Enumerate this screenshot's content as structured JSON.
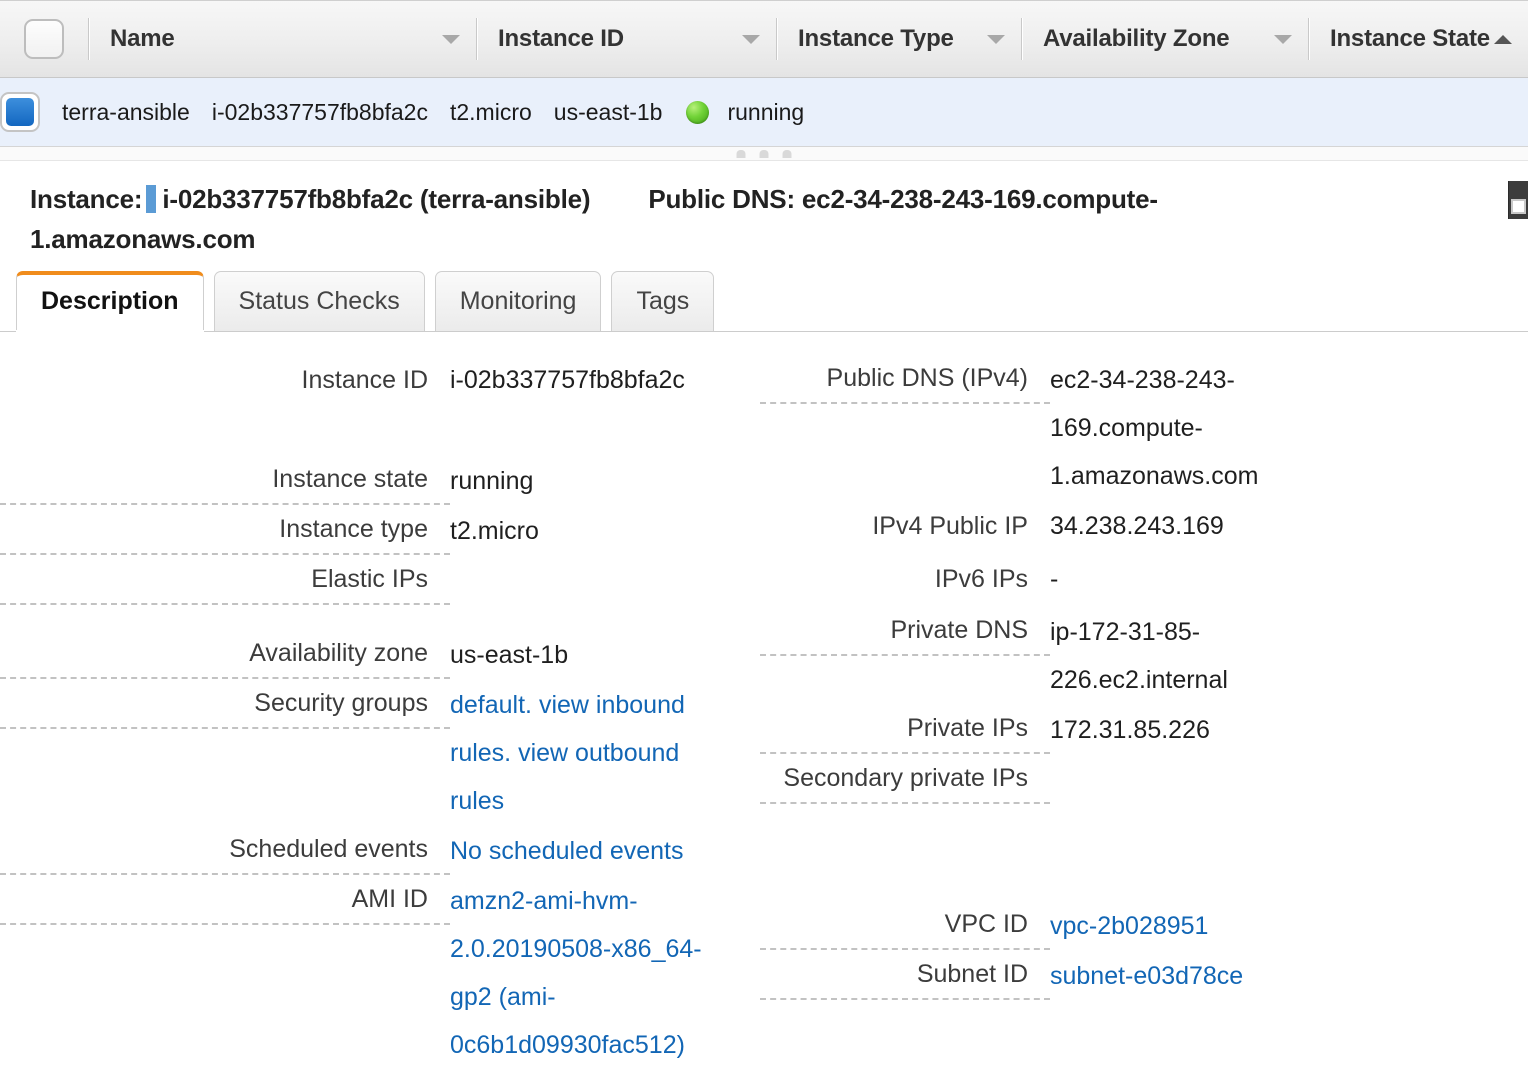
{
  "table": {
    "columns": [
      {
        "key": "select",
        "label": "",
        "icon": "checkbox-icon",
        "sort": "none"
      },
      {
        "key": "name",
        "label": "Name",
        "icon": "chevron-down-icon",
        "sort": "menu"
      },
      {
        "key": "instance_id",
        "label": "Instance ID",
        "icon": "chevron-down-icon",
        "sort": "menu"
      },
      {
        "key": "instance_type",
        "label": "Instance Type",
        "icon": "chevron-down-icon",
        "sort": "menu"
      },
      {
        "key": "availability_zone",
        "label": "Availability Zone",
        "icon": "chevron-down-icon",
        "sort": "menu"
      },
      {
        "key": "instance_state",
        "label": "Instance State",
        "icon": "sort-ascending-icon",
        "sort": "asc"
      }
    ],
    "rows": [
      {
        "selected": true,
        "name": "terra-ansible",
        "instance_id": "i-02b337757fb8bfa2c",
        "instance_type": "t2.micro",
        "availability_zone": "us-east-1b",
        "instance_state": "running",
        "state_color": "#6fd12f"
      }
    ]
  },
  "detail_header": {
    "instance_prefix": "Instance:",
    "instance_title": "i-02b337757fb8bfa2c (terra-ansible)",
    "dns_line1": "Public DNS: ec2-34-238-243-169.compute-",
    "dns_line2": "1.amazonaws.com"
  },
  "tabs": [
    {
      "label": "Description",
      "active": true
    },
    {
      "label": "Status Checks",
      "active": false
    },
    {
      "label": "Monitoring",
      "active": false
    },
    {
      "label": "Tags",
      "active": false
    }
  ],
  "details": {
    "left": [
      {
        "label": "Instance ID",
        "value": "i-02b337757fb8bfa2c",
        "tooltip": false,
        "link": false
      },
      {
        "label": "Instance state",
        "value": "running",
        "tooltip": true,
        "link": false
      },
      {
        "label": "Instance type",
        "value": "t2.micro",
        "tooltip": true,
        "link": false
      },
      {
        "label": "Elastic IPs",
        "value": "",
        "tooltip": true,
        "link": false
      },
      {
        "label": "Availability zone",
        "value": "us-east-1b",
        "tooltip": true,
        "link": false
      },
      {
        "label": "Security groups",
        "value": "default. view inbound rules. view outbound rules",
        "tooltip": true,
        "link": true
      },
      {
        "label": "Scheduled events",
        "value": "No scheduled events",
        "tooltip": true,
        "link": true
      },
      {
        "label": "AMI ID",
        "value": "amzn2-ami-hvm-2.0.20190508-x86_64-gp2 (ami-0c6b1d09930fac512)",
        "tooltip": true,
        "link": true
      }
    ],
    "right": [
      {
        "label": "Public DNS (IPv4)",
        "value": "ec2-34-238-243-169.compute-1.amazonaws.com",
        "tooltip": true,
        "link": false
      },
      {
        "label": "IPv4 Public IP",
        "value": "34.238.243.169",
        "tooltip": false,
        "link": false
      },
      {
        "label": "IPv6 IPs",
        "value": "-",
        "tooltip": false,
        "link": false
      },
      {
        "label": "Private DNS",
        "value": "ip-172-31-85-226.ec2.internal",
        "tooltip": true,
        "link": false
      },
      {
        "label": "Private IPs",
        "value": "172.31.85.226",
        "tooltip": true,
        "link": false
      },
      {
        "label": "Secondary private IPs",
        "value": "",
        "tooltip": true,
        "link": false
      },
      {
        "label": "VPC ID",
        "value": "vpc-2b028951",
        "tooltip": true,
        "link": true
      },
      {
        "label": "Subnet ID",
        "value": "subnet-e03d78ce",
        "tooltip": true,
        "link": true
      }
    ]
  },
  "colors": {
    "accent": "#f08c1c",
    "link": "#1266b5",
    "selected_row": "#e9f0fb",
    "running": "#6fd12f",
    "checkbox_checked": "#1367c0"
  }
}
